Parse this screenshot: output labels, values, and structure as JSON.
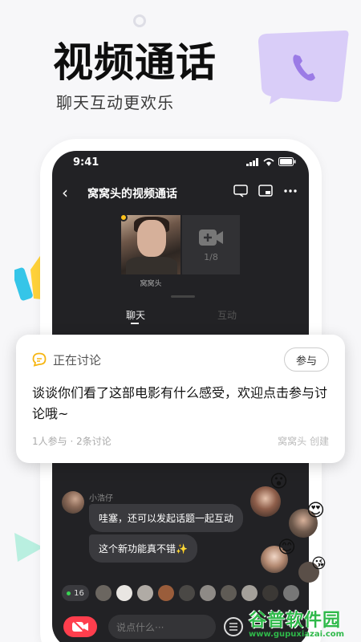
{
  "promo": {
    "headline": "视频通话",
    "subline": "聊天互动更欢乐"
  },
  "status_bar": {
    "time": "9:41"
  },
  "nav": {
    "title": "窝窝头的视频通话"
  },
  "video": {
    "host_name": "窝窝头",
    "slot_count": "1/8"
  },
  "tabs": [
    {
      "label": "聊天",
      "active": true
    },
    {
      "label": "互动",
      "active": false
    }
  ],
  "discussion_card": {
    "status_label": "正在讨论",
    "join_label": "参与",
    "body": "谈谈你们看了这部电影有什么感受，欢迎点击参与讨论哦~",
    "meta": "1人参与 · 2条讨论",
    "creator": "窝窝头 创建"
  },
  "chat": {
    "sender": "小浩仔",
    "messages": [
      "哇塞，还可以发起话题一起互动",
      "这个新功能真不错✨"
    ]
  },
  "audience": {
    "online_count": "16"
  },
  "input": {
    "placeholder": "说点什么···"
  },
  "watermark": {
    "title": "谷普软件园",
    "url": "www.gupuxiazai.com"
  },
  "colors": {
    "accent_purple": "#c9b8f5",
    "live_yellow": "#ffc21a",
    "camera_red": "#ff3e4d",
    "screen_bg": "#222225",
    "watermark_green": "#2fb94a"
  }
}
